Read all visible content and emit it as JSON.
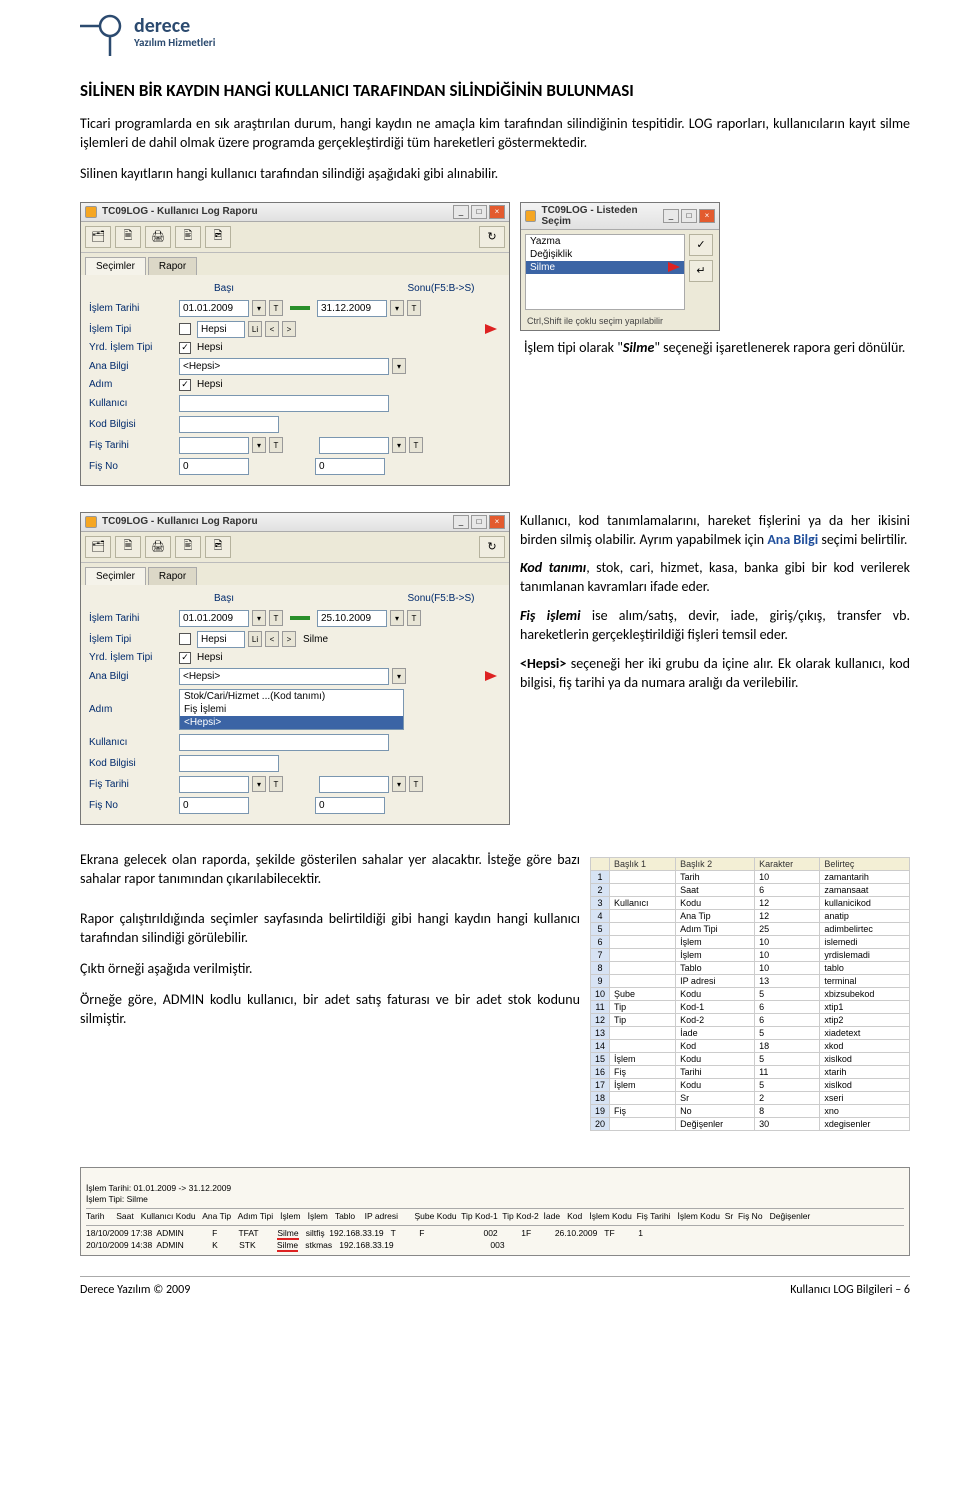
{
  "logo": {
    "title": "derece",
    "subtitle": "Yazılım Hizmetleri"
  },
  "doc": {
    "heading": "SİLİNEN BİR KAYDIN HANGİ KULLANICI TARAFINDAN SİLİNDİĞİNİN BULUNMASI",
    "p1": "Ticari programlarda en sık araştırılan durum, hangi kaydın ne amaçla kim tarafından silindiğinin tespitidir. LOG raporları, kullanıcıların kayıt silme işlemleri de dahil olmak üzere programda gerçekleştirdiği tüm hareketleri göstermektedir.",
    "p2": "Silinen kayıtların hangi kullanıcı tarafından silindiği aşağıdaki gibi alınabilir.",
    "caption1_pre": "İşlem tipi olarak \"",
    "caption1_em": "Silme",
    "caption1_post": "\" seçeneği işaretlenerek rapora geri dönülür.",
    "c2a": "Kullanıcı, kod tanımlamalarını, hareket fişlerini ya da her ikisini birden silmiş olabilir. Ayrım yapabilmek için ",
    "c2a_blue": "Ana Bilgi",
    "c2a_end": " seçimi belirtilir.",
    "c2b_b": "Kod tanımı",
    "c2b": ", stok, cari, hizmet, kasa, banka gibi bir kod verilerek tanımlanan kavramları ifade eder.",
    "c2c_b": "Fiş işlemi",
    "c2c": " ise alım/satış, devir, iade, giriş/çıkış, transfer vb. hareketlerin gerçekleştirildiği fişleri temsil eder.",
    "c2d_b": "<Hepsi>",
    "c2d": " seçeneği her iki grubu da içine alır. Ek olarak kullanıcı, kod bilgisi, fiş tarihi ya da numara aralığı da verilebilir.",
    "p3": "Ekrana gelecek olan raporda, şekilde gösterilen sahalar yer alacaktır. İsteğe göre bazı sahalar rapor tanımından çıkarılabilecektir.",
    "p4": "Rapor çalıştırıldığında seçimler sayfasında belirtildiği gibi hangi kaydın hangi kullanıcı tarafından silindiği görülebilir.",
    "p5": "Çıktı örneği aşağıda verilmiştir.",
    "p6": "Örneğe göre, ADMIN kodlu kullanıcı, bir adet satış faturası ve bir adet stok kodunu silmiştir."
  },
  "win1": {
    "title": "TC09LOG - Kullanıcı Log Raporu",
    "tab_sec": "Seçimler",
    "tab_rap": "Rapor",
    "hdr_basi": "Başı",
    "hdr_sonu": "Sonu(F5:B->S)",
    "labels": {
      "islem_tarihi": "İşlem Tarihi",
      "islem_tipi": "İşlem Tipi",
      "yrd_islem_tipi": "Yrd. İşlem Tipi",
      "ana_bilgi": "Ana Bilgi",
      "adim": "Adım",
      "kullanici": "Kullanıcı",
      "kod_bilgisi": "Kod Bilgisi",
      "fis_tarihi": "Fiş Tarihi",
      "fis_no": "Fiş No"
    },
    "vals": {
      "d1": "01.01.2009",
      "d2": "31.12.2009",
      "hepsi": "Hepsi",
      "hepsi_a": "<Hepsi>",
      "zero": "0"
    }
  },
  "win2": {
    "title": "TC09LOG - Listeden Seçim",
    "items": {
      "yazma": "Yazma",
      "degisiklik": "Değişiklik",
      "silme": "Silme"
    },
    "hint": "Ctrl,Shift ile çoklu seçim yapılabilir"
  },
  "win3": {
    "title": "TC09LOG - Kullanıcı Log Raporu",
    "d2": "25.10.2009",
    "silme": "Silme",
    "ana_opts": {
      "a": "Stok/Cari/Hizmet ...(Kod tanımı)",
      "b": "Fiş İşlemi",
      "c": "<Hepsi>"
    }
  },
  "rpt": {
    "headers": [
      "",
      "Başlık 1",
      "Başlık 2",
      "Karakter",
      "Belirteç"
    ],
    "rows": [
      [
        "1",
        "",
        "Tarih",
        "10",
        "zamantarih"
      ],
      [
        "2",
        "",
        "Saat",
        "6",
        "zamansaat"
      ],
      [
        "3",
        "Kullanıcı",
        "Kodu",
        "12",
        "kullanicikod"
      ],
      [
        "4",
        "",
        "Ana Tip",
        "12",
        "anatip"
      ],
      [
        "5",
        "",
        "Adım Tipi",
        "25",
        "adimbelirtec"
      ],
      [
        "6",
        "",
        "İşlem",
        "10",
        "islemedi"
      ],
      [
        "7",
        "",
        "İşlem",
        "10",
        "yrdislemadi"
      ],
      [
        "8",
        "",
        "Tablo",
        "10",
        "tablo"
      ],
      [
        "9",
        "",
        "IP adresi",
        "13",
        "terminal"
      ],
      [
        "10",
        "Şube",
        "Kodu",
        "5",
        "xbizsubekod"
      ],
      [
        "11",
        "Tip",
        "Kod-1",
        "6",
        "xtip1"
      ],
      [
        "12",
        "Tip",
        "Kod-2",
        "6",
        "xtip2"
      ],
      [
        "13",
        "",
        "İade",
        "5",
        "xiadetext"
      ],
      [
        "14",
        "",
        "Kod",
        "18",
        "xkod"
      ],
      [
        "15",
        "İşlem",
        "Kodu",
        "5",
        "xislkod"
      ],
      [
        "16",
        "Fiş",
        "Tarihi",
        "11",
        "xtarih"
      ],
      [
        "17",
        "İşlem",
        "Kodu",
        "5",
        "xislkod"
      ],
      [
        "18",
        "",
        "Sr",
        "2",
        "xseri"
      ],
      [
        "19",
        "Fiş",
        "No",
        "8",
        "xno"
      ],
      [
        "20",
        "",
        "Değişenler",
        "30",
        "xdegisenler"
      ]
    ]
  },
  "log": {
    "h1": "İşlem Tarihi: 01.01.2009 -> 31.12.2009",
    "h2": "İşlem Tipi: Silme",
    "cols": "Tarih     Saat   Kullanıcı Kodu   Ana Tip   Adım Tipi   İşlem   İşlem   Tablo    IP adresi       Şube Kodu  Tip Kod-1  Tip Kod-2  İade   Kod   İşlem Kodu  Fiş Tarihi   İşlem Kodu  Sr  Fiş No   Değişenler",
    "r1a": "18/10/2009 17:38  ADMIN            F         TFAT        ",
    "r1b": "Silme",
    "r1c": "   siltfiş  192.168.33.19   T          F                         002          1F          26.10.2009   TF          1",
    "r2a": "20/10/2009 14:38  ADMIN            K         STK         ",
    "r2b": "Silme",
    "r2c": "   stkmas   192.168.33.19                                         003"
  },
  "footer": {
    "left": "Derece Yazılım © 2009",
    "right": "Kullanıcı LOG Bilgileri – 6"
  }
}
